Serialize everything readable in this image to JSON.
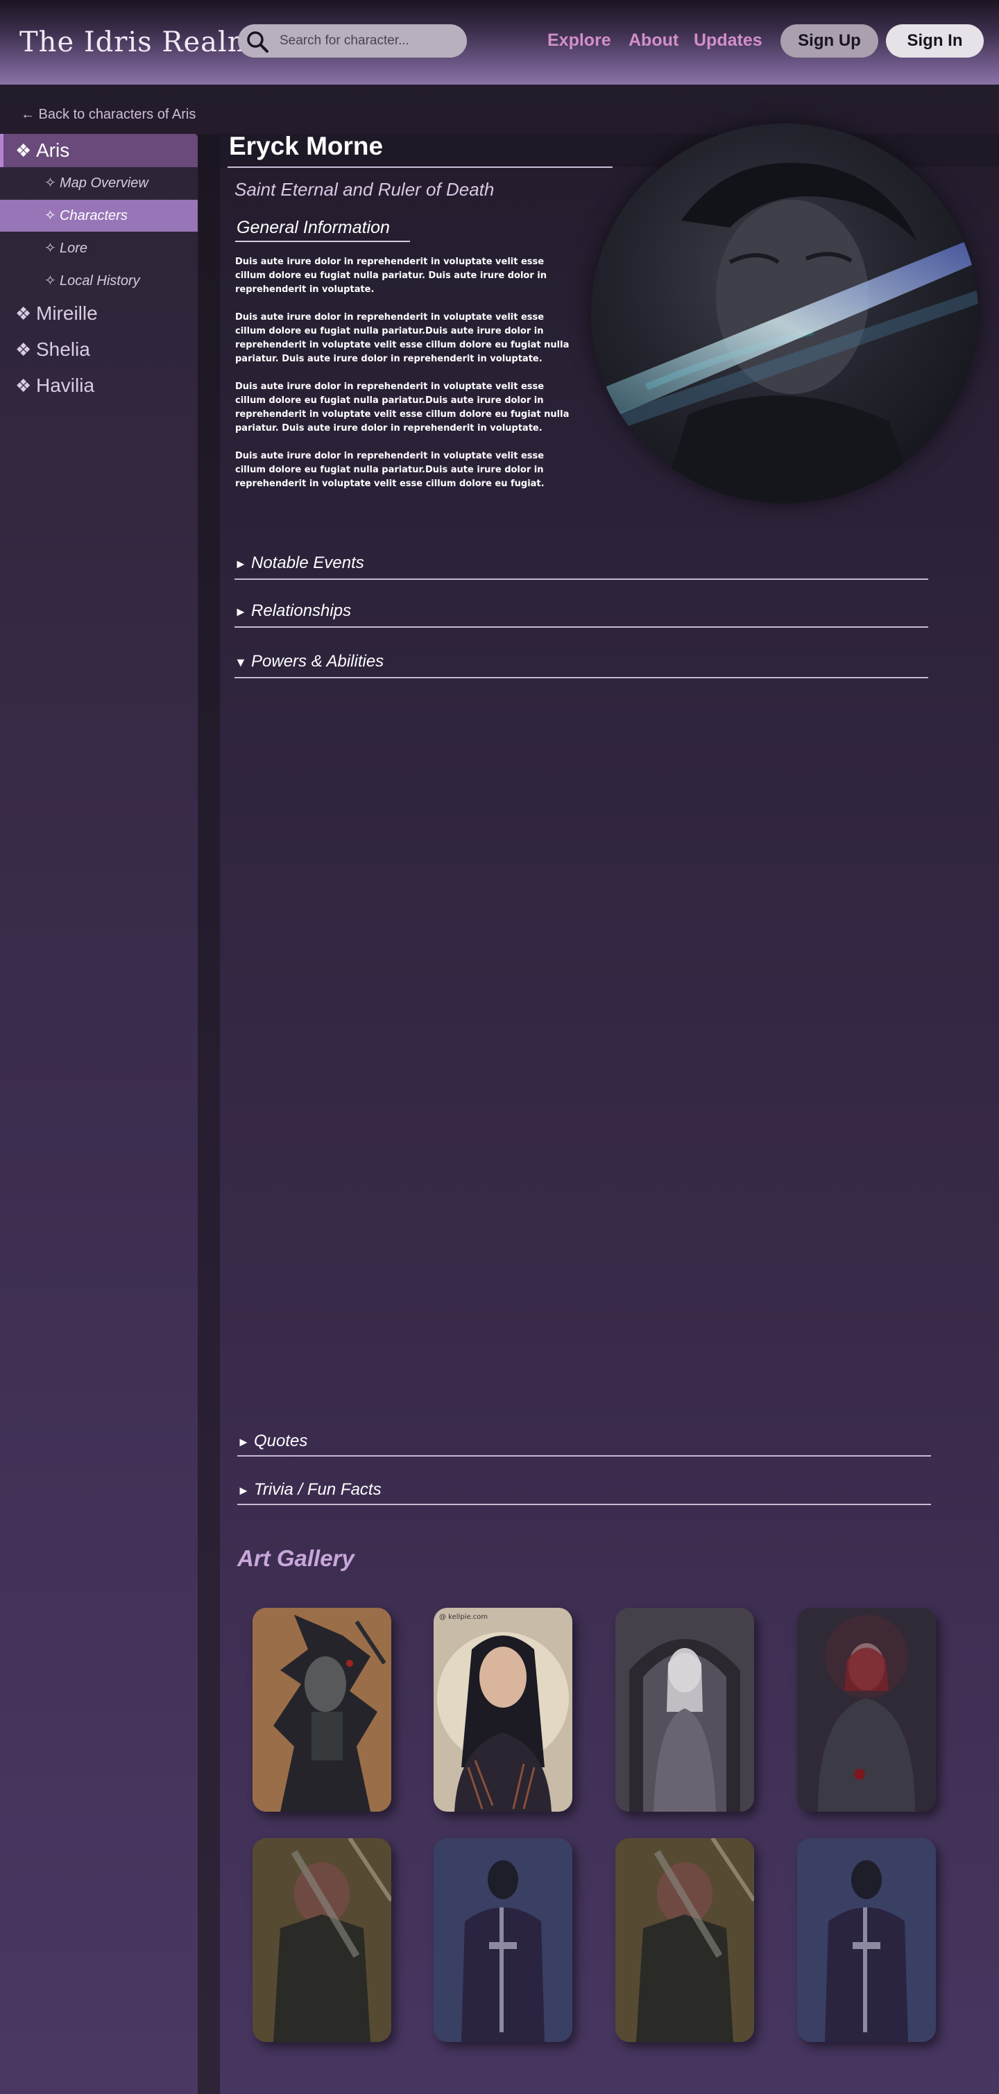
{
  "header": {
    "logo": "The Idris Realm",
    "search_placeholder": "Search for character...",
    "nav": [
      "Explore",
      "About",
      "Updates"
    ],
    "signup_label": "Sign Up",
    "signin_label": "Sign In"
  },
  "sidebar": {
    "back_label": "← Back to characters of Aris",
    "region_mark": "❖",
    "sub_mark": "✧",
    "regions": [
      {
        "label": "Aris",
        "active": true
      },
      {
        "label": "Mireille",
        "active": false
      },
      {
        "label": "Shelia",
        "active": false
      },
      {
        "label": "Havilia",
        "active": false
      }
    ],
    "subitems": [
      {
        "label": "Map Overview",
        "active": false
      },
      {
        "label": "Characters",
        "active": true
      },
      {
        "label": "Lore",
        "active": false
      },
      {
        "label": "Local History",
        "active": false
      }
    ]
  },
  "character": {
    "name": "Eryck Morne",
    "title": "Saint Eternal and Ruler of Death",
    "general_heading": "General Information",
    "paragraphs": [
      "Duis aute irure dolor in reprehenderit in voluptate velit esse cillum dolore eu fugiat nulla pariatur. Duis aute irure dolor in reprehenderit in voluptate.",
      "Duis aute irure dolor in reprehenderit in voluptate velit esse cillum dolore eu fugiat nulla pariatur.Duis aute irure dolor in reprehenderit in voluptate velit esse cillum dolore eu fugiat nulla pariatur. Duis aute irure dolor in reprehenderit in voluptate.",
      "Duis aute irure dolor in reprehenderit in voluptate velit esse cillum dolore eu fugiat nulla pariatur.Duis aute irure dolor in reprehenderit in voluptate velit esse cillum dolore eu fugiat nulla pariatur. Duis aute irure dolor in reprehenderit in voluptate.",
      "Duis aute irure dolor in reprehenderit in voluptate velit esse cillum dolore eu fugiat nulla pariatur.Duis aute irure dolor in reprehenderit in voluptate velit esse cillum dolore eu fugiat."
    ]
  },
  "sections": {
    "collapsed_arrow": "►",
    "expanded_arrow": "▼",
    "notable_events": "Notable Events",
    "relationships": "Relationships",
    "powers": "Powers & Abilities",
    "quotes": "Quotes",
    "trivia": "Trivia / Fun Facts"
  },
  "gallery": {
    "title": "Art Gallery",
    "watermark": "@ kellpie.com"
  },
  "colors": {
    "accent": "#9775b6",
    "nav_link": "#d38fc7",
    "gallery_title": "#c8a7da"
  }
}
